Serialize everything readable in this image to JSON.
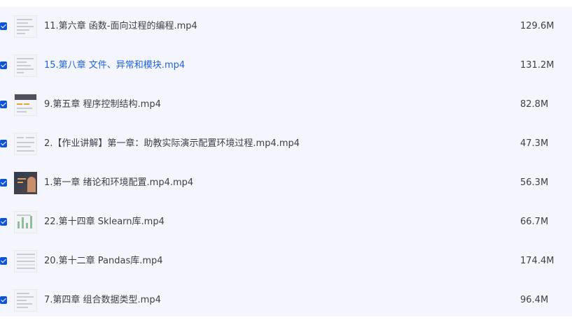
{
  "files": [
    {
      "name": "11.第六章 函数-面向过程的编程.mp4",
      "size": "129.6M",
      "checked": true,
      "thumbnail": "document-thumbnail"
    },
    {
      "name": "15.第八章 文件、异常和模块.mp4",
      "size": "131.2M",
      "checked": true,
      "thumbnail": "document-thumbnail",
      "highlighted": true
    },
    {
      "name": "9.第五章 程序控制结构.mp4",
      "size": "82.8M",
      "checked": true,
      "thumbnail": "slide-thumbnail"
    },
    {
      "name": "2.【作业讲解】第一章：助教实际演示配置环境过程.mp4.mp4",
      "size": "47.3M",
      "checked": true,
      "thumbnail": "document-thumbnail"
    },
    {
      "name": "1.第一章 绪论和环境配置.mp4.mp4",
      "size": "56.3M",
      "checked": true,
      "thumbnail": "video-thumbnail"
    },
    {
      "name": "22.第十四章 Sklearn库.mp4",
      "size": "66.7M",
      "checked": true,
      "thumbnail": "chart-thumbnail"
    },
    {
      "name": "20.第十二章 Pandas库.mp4",
      "size": "174.4M",
      "checked": true,
      "thumbnail": "table-thumbnail"
    },
    {
      "name": "7.第四章 组合数据类型.mp4",
      "size": "96.4M",
      "checked": true,
      "thumbnail": "document-thumbnail"
    }
  ],
  "colors": {
    "accent": "#0d55d6",
    "highlight_text": "#1f63e0",
    "list_background": "#f5f6fd",
    "text": "#3c4048"
  }
}
